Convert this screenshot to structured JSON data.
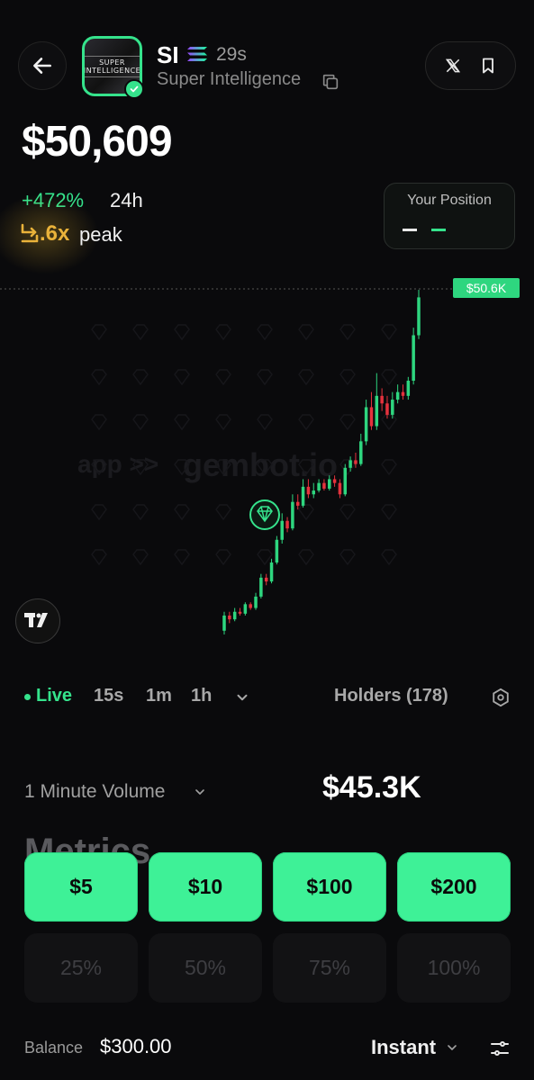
{
  "header": {
    "ticker": "SI",
    "age": "29s",
    "name": "Super Intelligence",
    "logo_text_line1": "SUPER",
    "logo_text_line2": "INTELLIGENCE"
  },
  "price": {
    "value": "$50,609",
    "change": "+472%",
    "change_period": "24h",
    "peak_multiplier": ".6x",
    "peak_label": "peak"
  },
  "position": {
    "title": "Your Position"
  },
  "chart": {
    "current_price_label": "$50.6K",
    "watermark_prefix": "app >>",
    "watermark_brand": "gembot.io"
  },
  "timeframes": {
    "live": "Live",
    "options": [
      "15s",
      "1m",
      "1h"
    ],
    "holders": "Holders (178)"
  },
  "volume": {
    "label": "1 Minute Volume",
    "value": "$45.3K"
  },
  "metrics_heading": "Metrics",
  "amounts": [
    "$5",
    "$10",
    "$100",
    "$200"
  ],
  "percents": [
    "25%",
    "50%",
    "75%",
    "100%"
  ],
  "footer": {
    "balance_label": "Balance",
    "balance_value": "$300.00",
    "mode": "Instant"
  },
  "colors": {
    "accent": "#3ef197",
    "up": "#2ed67f",
    "down": "#e5323d",
    "peak": "#e9b23a",
    "background": "#0a0a0c"
  },
  "chart_data": {
    "type": "candlestick",
    "title": "",
    "last_price_label": "$50.6K",
    "trend": "rising",
    "candles": [
      {
        "o": 1.0,
        "c": 1.4,
        "h": 1.5,
        "l": 0.9
      },
      {
        "o": 1.4,
        "c": 1.3,
        "h": 1.5,
        "l": 1.2
      },
      {
        "o": 1.3,
        "c": 1.5,
        "h": 1.6,
        "l": 1.25
      },
      {
        "o": 1.5,
        "c": 1.45,
        "h": 1.6,
        "l": 1.4
      },
      {
        "o": 1.45,
        "c": 1.7,
        "h": 1.75,
        "l": 1.4
      },
      {
        "o": 1.7,
        "c": 1.6,
        "h": 1.75,
        "l": 1.55
      },
      {
        "o": 1.6,
        "c": 1.9,
        "h": 2.0,
        "l": 1.55
      },
      {
        "o": 1.9,
        "c": 2.4,
        "h": 2.5,
        "l": 1.85
      },
      {
        "o": 2.4,
        "c": 2.3,
        "h": 2.5,
        "l": 2.2
      },
      {
        "o": 2.3,
        "c": 2.8,
        "h": 2.9,
        "l": 2.25
      },
      {
        "o": 2.8,
        "c": 3.4,
        "h": 3.5,
        "l": 2.75
      },
      {
        "o": 3.4,
        "c": 3.9,
        "h": 4.1,
        "l": 3.3
      },
      {
        "o": 3.9,
        "c": 3.7,
        "h": 4.0,
        "l": 3.6
      },
      {
        "o": 3.7,
        "c": 4.4,
        "h": 4.6,
        "l": 3.65
      },
      {
        "o": 4.4,
        "c": 4.3,
        "h": 4.6,
        "l": 4.2
      },
      {
        "o": 4.3,
        "c": 4.8,
        "h": 5.0,
        "l": 4.25
      },
      {
        "o": 4.8,
        "c": 4.6,
        "h": 5.0,
        "l": 4.5
      },
      {
        "o": 4.6,
        "c": 4.7,
        "h": 4.9,
        "l": 4.5
      },
      {
        "o": 4.7,
        "c": 4.9,
        "h": 5.0,
        "l": 4.65
      },
      {
        "o": 4.9,
        "c": 4.75,
        "h": 5.0,
        "l": 4.7
      },
      {
        "o": 4.75,
        "c": 5.0,
        "h": 5.1,
        "l": 4.7
      },
      {
        "o": 5.0,
        "c": 4.9,
        "h": 5.1,
        "l": 4.8
      },
      {
        "o": 4.9,
        "c": 4.6,
        "h": 5.0,
        "l": 4.5
      },
      {
        "o": 4.6,
        "c": 5.3,
        "h": 5.4,
        "l": 4.55
      },
      {
        "o": 5.3,
        "c": 5.5,
        "h": 5.6,
        "l": 5.2
      },
      {
        "o": 5.5,
        "c": 5.4,
        "h": 5.7,
        "l": 5.3
      },
      {
        "o": 5.4,
        "c": 6.0,
        "h": 6.2,
        "l": 5.35
      },
      {
        "o": 6.0,
        "c": 6.9,
        "h": 7.1,
        "l": 5.9
      },
      {
        "o": 6.9,
        "c": 6.4,
        "h": 7.3,
        "l": 6.3
      },
      {
        "o": 6.4,
        "c": 7.2,
        "h": 7.8,
        "l": 6.3
      },
      {
        "o": 7.2,
        "c": 7.0,
        "h": 7.4,
        "l": 6.8
      },
      {
        "o": 7.0,
        "c": 6.7,
        "h": 7.2,
        "l": 6.6
      },
      {
        "o": 6.7,
        "c": 7.1,
        "h": 7.3,
        "l": 6.6
      },
      {
        "o": 7.1,
        "c": 7.3,
        "h": 7.5,
        "l": 7.0
      },
      {
        "o": 7.3,
        "c": 7.2,
        "h": 7.5,
        "l": 7.1
      },
      {
        "o": 7.2,
        "c": 7.6,
        "h": 7.7,
        "l": 7.1
      },
      {
        "o": 7.6,
        "c": 8.8,
        "h": 9.0,
        "l": 7.5
      },
      {
        "o": 8.8,
        "c": 9.8,
        "h": 10.0,
        "l": 8.7
      }
    ]
  }
}
